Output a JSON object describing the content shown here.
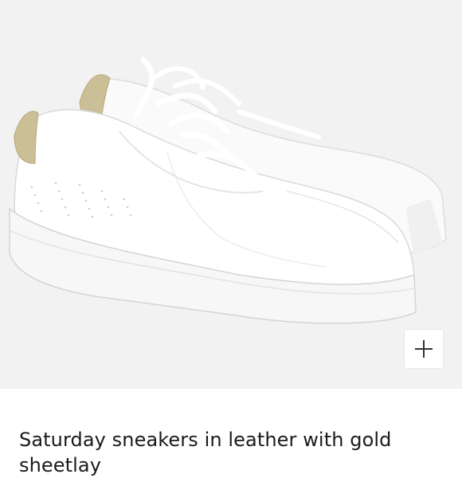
{
  "product": {
    "image_alt": "White leather sneakers with gold heel tab",
    "title": "Saturday sneakers in leather with gold sheetlay"
  },
  "controls": {
    "zoom_icon": "plus-icon"
  },
  "colors": {
    "image_background": "#f2f2f2",
    "text": "#1a1a1a",
    "heel_gold": "#cbbf97"
  }
}
